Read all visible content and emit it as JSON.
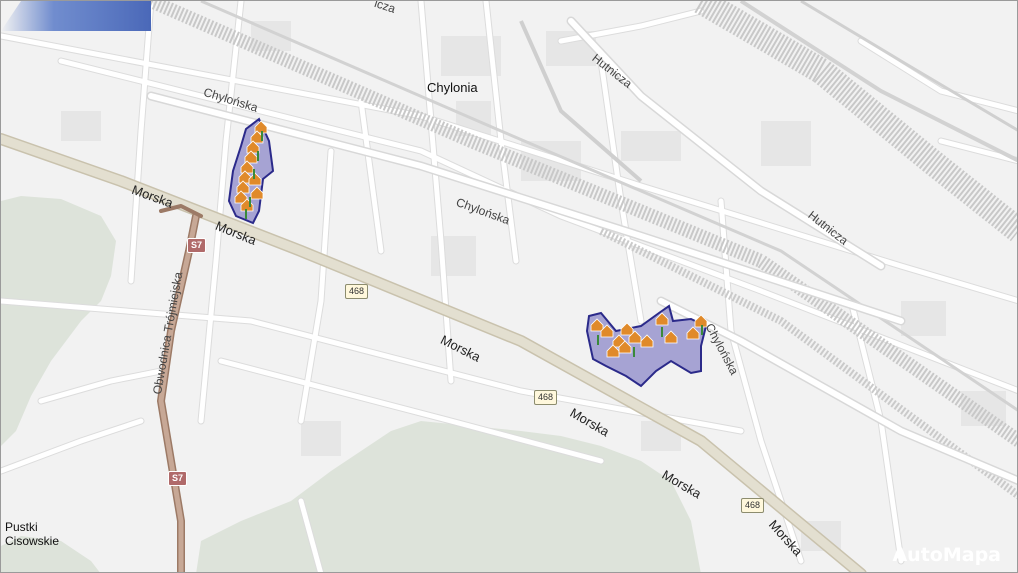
{
  "map": {
    "places": {
      "chylonia": "Chylonia",
      "pustki_line1": "Pustki",
      "pustki_line2": "Cisowskie"
    },
    "streets": {
      "chylonska_1": "Chylońska",
      "chylonska_2": "Chylońska",
      "chylonska_3": "Chylońska",
      "hutnicza_1": "Hutnicza",
      "hutnicza_2": "Hutnicza",
      "morska_1": "Morska",
      "morska_2": "Morska",
      "morska_3": "Morska",
      "morska_4": "Morska",
      "morska_5": "Morska",
      "morska_6": "Morska",
      "obwodnica": "Obwodnica Trójmiejska",
      "top_fragment": "icza"
    },
    "shields": {
      "s7_a": "S7",
      "s7_b": "S7",
      "r468_a": "468",
      "r468_b": "468",
      "r468_c": "468"
    },
    "colors": {
      "background": "#f2f2f2",
      "street": "#ffffff",
      "street_casing": "#dcdcdc",
      "main_road": "#d9d4c4",
      "expressway": "#b89a88",
      "railway": "#c8c8c8",
      "forest": "#dde3da",
      "highlight_fill": "#8c88c8",
      "highlight_outline": "#2b2a8a",
      "house_marker": "#e08a2a"
    },
    "logo": "AutoMapa"
  }
}
